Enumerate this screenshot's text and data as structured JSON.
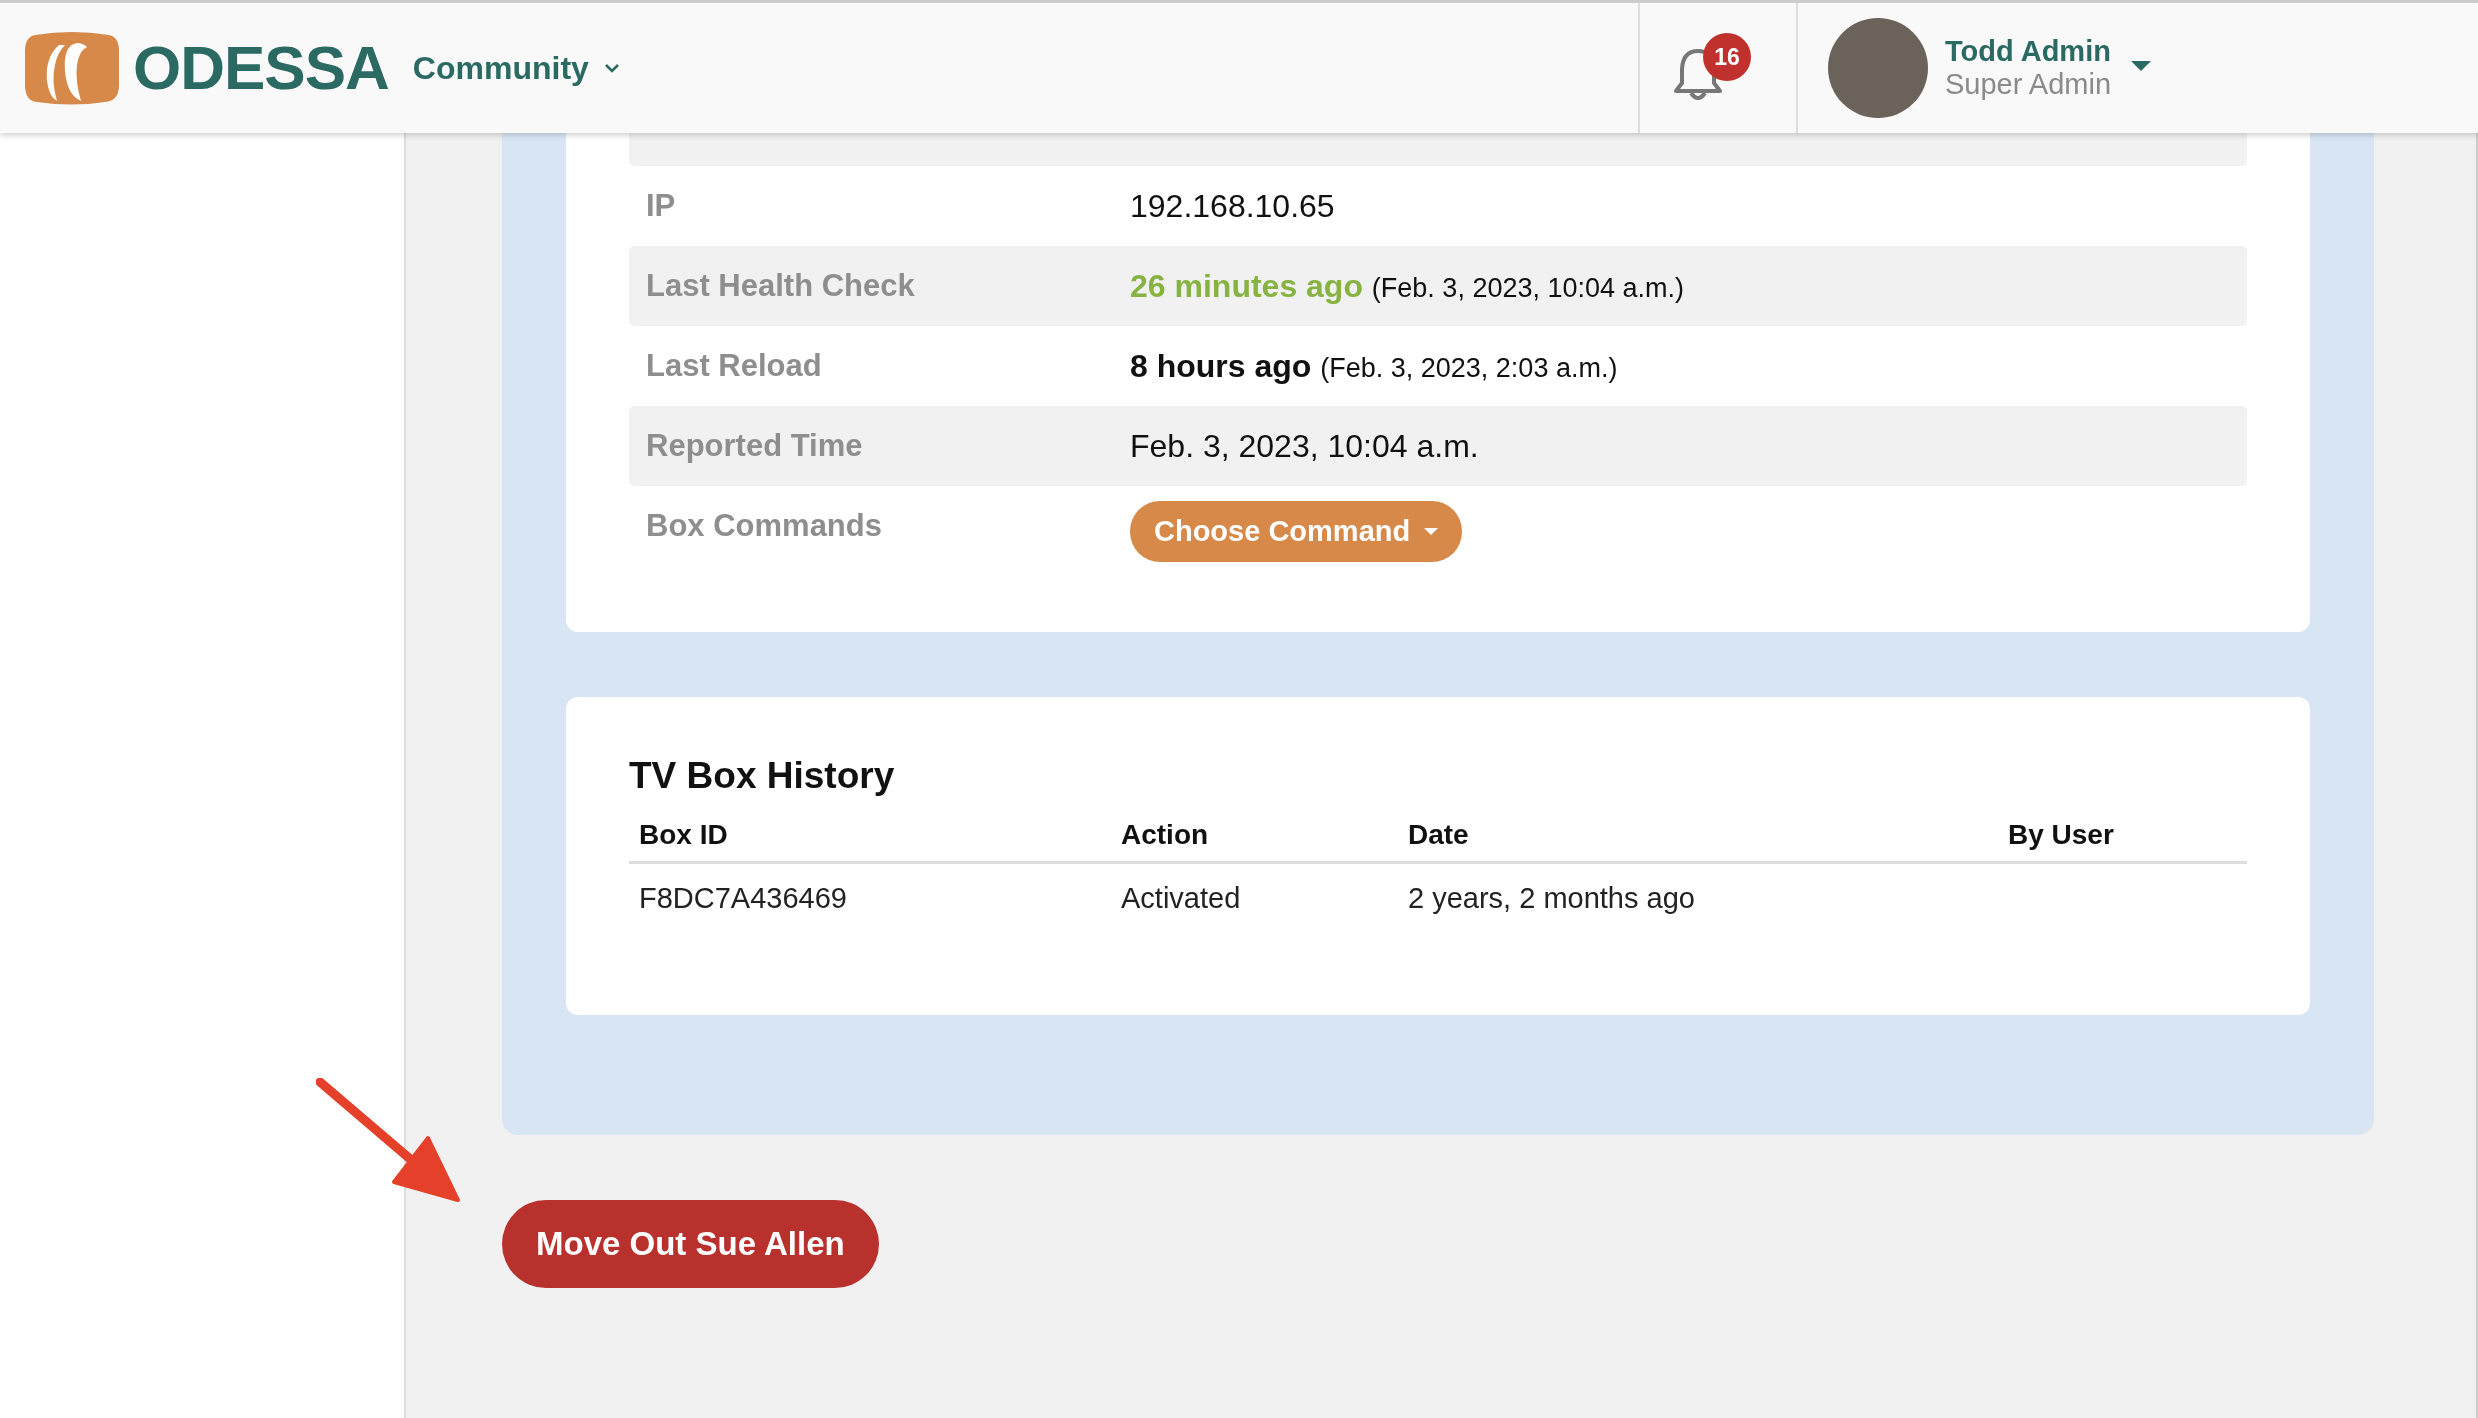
{
  "header": {
    "brand": "ODESSA",
    "community_menu": "Community",
    "notifications_count": "16",
    "user": {
      "name": "Todd Admin",
      "role": "Super Admin"
    }
  },
  "details": {
    "rows": [
      {
        "label": "IP",
        "kind": "text",
        "value": "192.168.10.65"
      },
      {
        "label": "Last Health Check",
        "kind": "relative",
        "relative": "26 minutes ago",
        "color": "#86b341",
        "absolute": "(Feb. 3, 2023, 10:04 a.m.)"
      },
      {
        "label": "Last Reload",
        "kind": "relative",
        "relative": "8 hours ago",
        "color": "#111111",
        "absolute": "(Feb. 3, 2023, 2:03 a.m.)"
      },
      {
        "label": "Reported Time",
        "kind": "text",
        "value": "Feb. 3, 2023, 10:04 a.m."
      },
      {
        "label": "Box Commands",
        "kind": "button",
        "button": "Choose Command"
      }
    ]
  },
  "history": {
    "title": "TV Box History",
    "columns": [
      "Box ID",
      "Action",
      "Date",
      "By User"
    ],
    "rows": [
      {
        "box_id": "F8DC7A436469",
        "action": "Activated",
        "date": "2 years, 2 months ago"
      }
    ]
  },
  "move_out_button": "Move Out Sue Allen"
}
